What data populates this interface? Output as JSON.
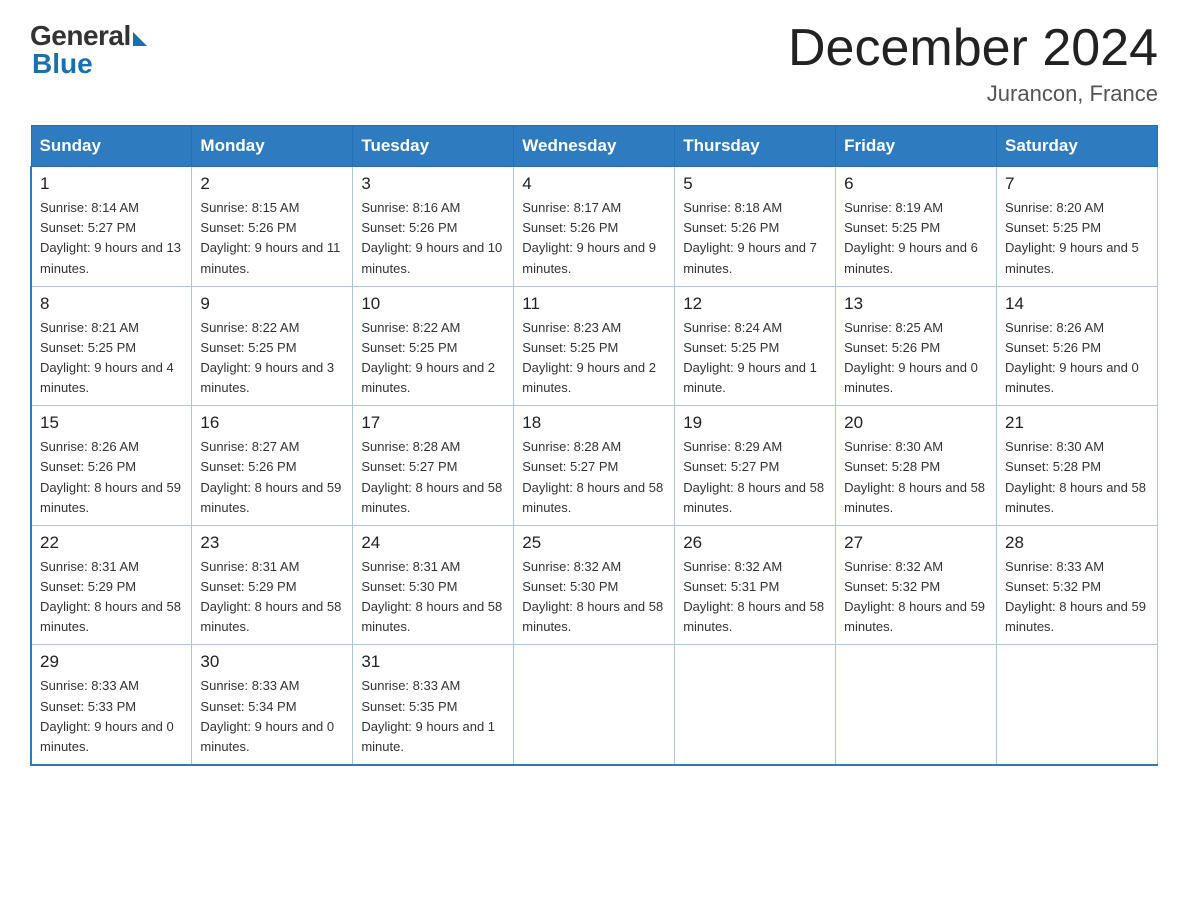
{
  "logo": {
    "general": "General",
    "blue": "Blue"
  },
  "title": "December 2024",
  "location": "Jurancon, France",
  "days_of_week": [
    "Sunday",
    "Monday",
    "Tuesday",
    "Wednesday",
    "Thursday",
    "Friday",
    "Saturday"
  ],
  "weeks": [
    [
      {
        "day": "1",
        "sunrise": "8:14 AM",
        "sunset": "5:27 PM",
        "daylight": "9 hours and 13 minutes."
      },
      {
        "day": "2",
        "sunrise": "8:15 AM",
        "sunset": "5:26 PM",
        "daylight": "9 hours and 11 minutes."
      },
      {
        "day": "3",
        "sunrise": "8:16 AM",
        "sunset": "5:26 PM",
        "daylight": "9 hours and 10 minutes."
      },
      {
        "day": "4",
        "sunrise": "8:17 AM",
        "sunset": "5:26 PM",
        "daylight": "9 hours and 9 minutes."
      },
      {
        "day": "5",
        "sunrise": "8:18 AM",
        "sunset": "5:26 PM",
        "daylight": "9 hours and 7 minutes."
      },
      {
        "day": "6",
        "sunrise": "8:19 AM",
        "sunset": "5:25 PM",
        "daylight": "9 hours and 6 minutes."
      },
      {
        "day": "7",
        "sunrise": "8:20 AM",
        "sunset": "5:25 PM",
        "daylight": "9 hours and 5 minutes."
      }
    ],
    [
      {
        "day": "8",
        "sunrise": "8:21 AM",
        "sunset": "5:25 PM",
        "daylight": "9 hours and 4 minutes."
      },
      {
        "day": "9",
        "sunrise": "8:22 AM",
        "sunset": "5:25 PM",
        "daylight": "9 hours and 3 minutes."
      },
      {
        "day": "10",
        "sunrise": "8:22 AM",
        "sunset": "5:25 PM",
        "daylight": "9 hours and 2 minutes."
      },
      {
        "day": "11",
        "sunrise": "8:23 AM",
        "sunset": "5:25 PM",
        "daylight": "9 hours and 2 minutes."
      },
      {
        "day": "12",
        "sunrise": "8:24 AM",
        "sunset": "5:25 PM",
        "daylight": "9 hours and 1 minute."
      },
      {
        "day": "13",
        "sunrise": "8:25 AM",
        "sunset": "5:26 PM",
        "daylight": "9 hours and 0 minutes."
      },
      {
        "day": "14",
        "sunrise": "8:26 AM",
        "sunset": "5:26 PM",
        "daylight": "9 hours and 0 minutes."
      }
    ],
    [
      {
        "day": "15",
        "sunrise": "8:26 AM",
        "sunset": "5:26 PM",
        "daylight": "8 hours and 59 minutes."
      },
      {
        "day": "16",
        "sunrise": "8:27 AM",
        "sunset": "5:26 PM",
        "daylight": "8 hours and 59 minutes."
      },
      {
        "day": "17",
        "sunrise": "8:28 AM",
        "sunset": "5:27 PM",
        "daylight": "8 hours and 58 minutes."
      },
      {
        "day": "18",
        "sunrise": "8:28 AM",
        "sunset": "5:27 PM",
        "daylight": "8 hours and 58 minutes."
      },
      {
        "day": "19",
        "sunrise": "8:29 AM",
        "sunset": "5:27 PM",
        "daylight": "8 hours and 58 minutes."
      },
      {
        "day": "20",
        "sunrise": "8:30 AM",
        "sunset": "5:28 PM",
        "daylight": "8 hours and 58 minutes."
      },
      {
        "day": "21",
        "sunrise": "8:30 AM",
        "sunset": "5:28 PM",
        "daylight": "8 hours and 58 minutes."
      }
    ],
    [
      {
        "day": "22",
        "sunrise": "8:31 AM",
        "sunset": "5:29 PM",
        "daylight": "8 hours and 58 minutes."
      },
      {
        "day": "23",
        "sunrise": "8:31 AM",
        "sunset": "5:29 PM",
        "daylight": "8 hours and 58 minutes."
      },
      {
        "day": "24",
        "sunrise": "8:31 AM",
        "sunset": "5:30 PM",
        "daylight": "8 hours and 58 minutes."
      },
      {
        "day": "25",
        "sunrise": "8:32 AM",
        "sunset": "5:30 PM",
        "daylight": "8 hours and 58 minutes."
      },
      {
        "day": "26",
        "sunrise": "8:32 AM",
        "sunset": "5:31 PM",
        "daylight": "8 hours and 58 minutes."
      },
      {
        "day": "27",
        "sunrise": "8:32 AM",
        "sunset": "5:32 PM",
        "daylight": "8 hours and 59 minutes."
      },
      {
        "day": "28",
        "sunrise": "8:33 AM",
        "sunset": "5:32 PM",
        "daylight": "8 hours and 59 minutes."
      }
    ],
    [
      {
        "day": "29",
        "sunrise": "8:33 AM",
        "sunset": "5:33 PM",
        "daylight": "9 hours and 0 minutes."
      },
      {
        "day": "30",
        "sunrise": "8:33 AM",
        "sunset": "5:34 PM",
        "daylight": "9 hours and 0 minutes."
      },
      {
        "day": "31",
        "sunrise": "8:33 AM",
        "sunset": "5:35 PM",
        "daylight": "9 hours and 1 minute."
      },
      null,
      null,
      null,
      null
    ]
  ]
}
